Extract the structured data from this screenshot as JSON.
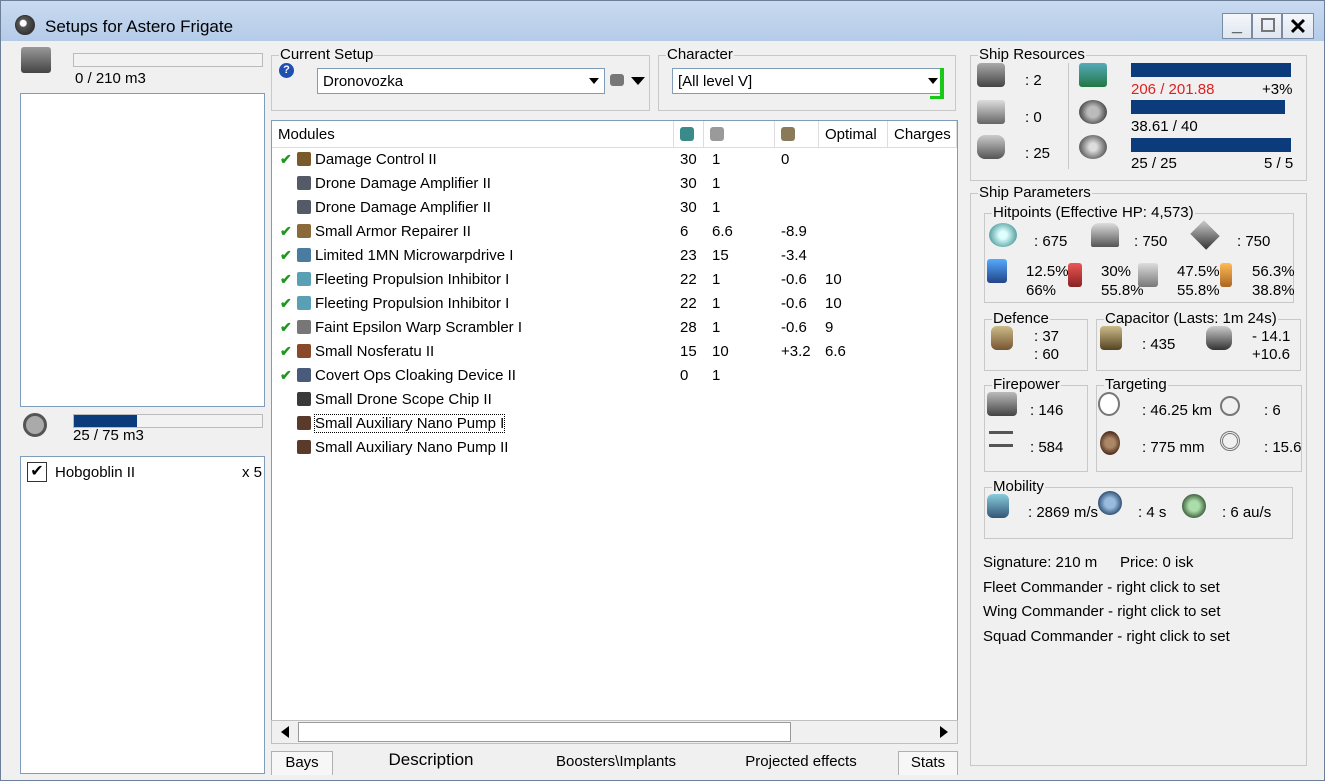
{
  "window": {
    "title": "Setups for Astero Frigate"
  },
  "left": {
    "cargo_text": "0 / 210 m3",
    "drone_text": "25 / 75 m3",
    "drone_fill": 0.333,
    "drones": [
      {
        "name": "Hobgoblin II",
        "qty": "x 5",
        "checked": true
      }
    ]
  },
  "current_setup": {
    "label": "Current Setup",
    "value": "Dronovozka"
  },
  "character": {
    "label": "Character",
    "value": "[All level V]"
  },
  "modules": {
    "headers": [
      "Modules",
      "",
      "",
      "",
      "Optimal",
      "Charges"
    ],
    "rows": [
      {
        "active": true,
        "name": "Damage Control II",
        "c1": "30",
        "c2": "1",
        "c3": "0",
        "c4": "",
        "icon_color": "#7a5a2a"
      },
      {
        "active": false,
        "name": "Drone Damage Amplifier II",
        "c1": "30",
        "c2": "1",
        "c3": "",
        "c4": "",
        "icon_color": "#555b66"
      },
      {
        "active": false,
        "name": "Drone Damage Amplifier II",
        "c1": "30",
        "c2": "1",
        "c3": "",
        "c4": "",
        "icon_color": "#555b66"
      },
      {
        "active": true,
        "name": "Small Armor Repairer II",
        "c1": "6",
        "c2": "6.6",
        "c3": "-8.9",
        "c4": "",
        "icon_color": "#8a6a3a"
      },
      {
        "active": true,
        "name": "Limited 1MN Microwarpdrive I",
        "c1": "23",
        "c2": "15",
        "c3": "-3.4",
        "c4": "",
        "icon_color": "#4a7ca0"
      },
      {
        "active": true,
        "name": "Fleeting Propulsion Inhibitor I",
        "c1": "22",
        "c2": "1",
        "c3": "-0.6",
        "c4": "10",
        "icon_color": "#5aa0b4"
      },
      {
        "active": true,
        "name": "Fleeting Propulsion Inhibitor I",
        "c1": "22",
        "c2": "1",
        "c3": "-0.6",
        "c4": "10",
        "icon_color": "#5aa0b4"
      },
      {
        "active": true,
        "name": "Faint Epsilon Warp Scrambler I",
        "c1": "28",
        "c2": "1",
        "c3": "-0.6",
        "c4": "9",
        "icon_color": "#777777"
      },
      {
        "active": true,
        "name": "Small Nosferatu II",
        "c1": "15",
        "c2": "10",
        "c3": "+3.2",
        "c4": "6.6",
        "icon_color": "#8a4a2a"
      },
      {
        "active": true,
        "name": "Covert Ops Cloaking Device II",
        "c1": "0",
        "c2": "1",
        "c3": "",
        "c4": "",
        "icon_color": "#4a5a7a"
      },
      {
        "active": false,
        "name": "Small Drone Scope Chip II",
        "c1": "",
        "c2": "",
        "c3": "",
        "c4": "",
        "icon_color": "#3a3a3a"
      },
      {
        "active": false,
        "name": "Small Auxiliary Nano Pump I",
        "c1": "",
        "c2": "",
        "c3": "",
        "c4": "",
        "icon_color": "#5a3a2a",
        "selected": true
      },
      {
        "active": false,
        "name": "Small Auxiliary Nano Pump II",
        "c1": "",
        "c2": "",
        "c3": "",
        "c4": "",
        "icon_color": "#5a3a2a"
      }
    ]
  },
  "tabs": [
    "Bays",
    "Description",
    "Boosters\\Implants",
    "Projected effects",
    "Stats"
  ],
  "ship_resources": {
    "label": "Ship Resources",
    "hardpoints": [
      ": 2",
      ": 0",
      ": 25"
    ],
    "cpu": {
      "text": "206 / 201.88",
      "extra": "+3%",
      "fill": 1.0
    },
    "power": {
      "text": "38.61 / 40",
      "fill": 0.965
    },
    "drone_bw": {
      "text": "25 / 25",
      "extra": "5 / 5",
      "fill": 1.0
    }
  },
  "ship_parameters": {
    "label": "Ship Parameters",
    "hitpoints": {
      "label": "Hitpoints (Effective HP: 4,573)",
      "values": [
        ": 675",
        ": 750",
        ": 750"
      ],
      "resists": [
        {
          "top": "12.5%",
          "bottom": "66%"
        },
        {
          "top": "30%",
          "bottom": "55.8%"
        },
        {
          "top": "47.5%",
          "bottom": "55.8%"
        },
        {
          "top": "56.3%",
          "bottom": "38.8%"
        }
      ]
    },
    "defence": {
      "label": "Defence",
      "top": ": 37",
      "bottom": ": 60"
    },
    "capacitor": {
      "label": "Capacitor (Lasts: 1m 24s)",
      "value": ": 435",
      "top": "- 14.1",
      "bottom": "+10.6"
    },
    "firepower": {
      "label": "Firepower",
      "top": ": 146",
      "bottom": ": 584"
    },
    "targeting": {
      "label": "Targeting",
      "range": ": 46.25 km",
      "targets": ": 6",
      "sig": ": 775 mm",
      "scan": ": 15.6"
    },
    "mobility": {
      "label": "Mobility",
      "speed": ": 2869 m/s",
      "align": ": 4 s",
      "warp": ": 6 au/s"
    }
  },
  "footer_info": {
    "signature": "Signature: 210 m",
    "price": "Price: 0 isk",
    "fleet": "Fleet Commander - right click to set",
    "wing": "Wing Commander - right click to set",
    "squad": "Squad Commander - right click to set"
  },
  "colors": {
    "bar": "#0c3b7c",
    "check": "#1e9a1e",
    "overload": "#e02020",
    "indicator": "#18c918"
  }
}
